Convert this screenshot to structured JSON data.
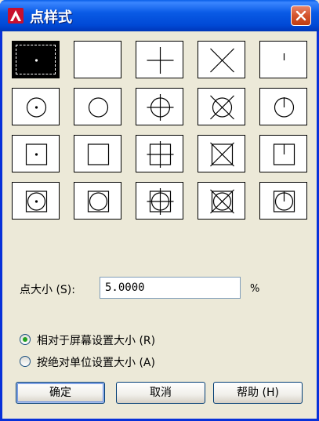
{
  "window": {
    "title": "点样式"
  },
  "icons": {
    "app": "autocad-a-icon",
    "close": "close-icon",
    "radio_selected": "radio-selected-icon",
    "radio_unselected": "radio-unselected-icon"
  },
  "colors": {
    "titlebar": "#0a5be6",
    "close_button": "#d4542c",
    "dialog_background": "#ece9d8",
    "radio_dot": "#21a121",
    "input_border": "#7f9db9"
  },
  "point_styles": {
    "selected_index": 0,
    "rows": [
      [
        {
          "name": "dot",
          "center": "dot",
          "circle": false,
          "square": false
        },
        {
          "name": "none",
          "center": "none",
          "circle": false,
          "square": false
        },
        {
          "name": "plus",
          "center": "plus",
          "circle": false,
          "square": false
        },
        {
          "name": "cross",
          "center": "x",
          "circle": false,
          "square": false
        },
        {
          "name": "tick",
          "center": "tick",
          "circle": false,
          "square": false
        }
      ],
      [
        {
          "name": "circle-dot",
          "center": "dot",
          "circle": true,
          "square": false
        },
        {
          "name": "circle",
          "center": "none",
          "circle": true,
          "square": false
        },
        {
          "name": "circle-plus",
          "center": "plus",
          "circle": true,
          "square": false
        },
        {
          "name": "circle-cross",
          "center": "x",
          "circle": true,
          "square": false
        },
        {
          "name": "circle-tick",
          "center": "tick",
          "circle": true,
          "square": false
        }
      ],
      [
        {
          "name": "square-dot",
          "center": "dot",
          "circle": false,
          "square": true
        },
        {
          "name": "square",
          "center": "none",
          "circle": false,
          "square": true
        },
        {
          "name": "square-plus",
          "center": "plus",
          "circle": false,
          "square": true
        },
        {
          "name": "square-cross",
          "center": "x",
          "circle": false,
          "square": true
        },
        {
          "name": "square-tick",
          "center": "tick",
          "circle": false,
          "square": true
        }
      ],
      [
        {
          "name": "circle-square-dot",
          "center": "dot",
          "circle": true,
          "square": true
        },
        {
          "name": "circle-square",
          "center": "none",
          "circle": true,
          "square": true
        },
        {
          "name": "circle-square-plus",
          "center": "plus",
          "circle": true,
          "square": true
        },
        {
          "name": "circle-square-cross",
          "center": "x",
          "circle": true,
          "square": true
        },
        {
          "name": "circle-square-tick",
          "center": "tick",
          "circle": true,
          "square": true
        }
      ]
    ]
  },
  "point_size": {
    "label": "点大小 (S):",
    "value": "5.0000",
    "unit": "%"
  },
  "size_mode": {
    "options": [
      {
        "label": "相对于屏幕设置大小 (R)",
        "selected": true
      },
      {
        "label": "按绝对单位设置大小 (A)",
        "selected": false
      }
    ]
  },
  "buttons": {
    "ok": "确定",
    "cancel": "取消",
    "help": "帮助 (H)"
  }
}
